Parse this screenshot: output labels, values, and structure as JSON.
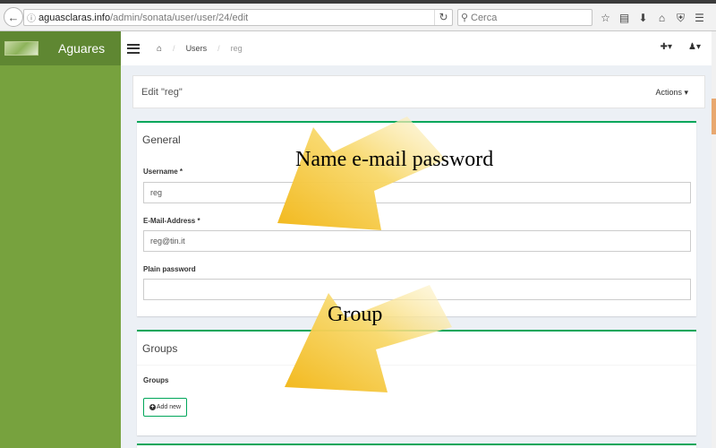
{
  "browser": {
    "url_host": "aguasclaras.info",
    "url_path": "/admin/sonata/user/user/24/edit",
    "search_placeholder": "Cerca"
  },
  "sidebar": {
    "brand": "Aguares"
  },
  "breadcrumb": {
    "items": [
      "Users"
    ],
    "current": "reg"
  },
  "page": {
    "title": "Edit \"reg\"",
    "actions_label": "Actions"
  },
  "general": {
    "title": "General",
    "username_label": "Username *",
    "username_value": "reg",
    "email_label": "E-Mail-Address *",
    "email_value": "reg@tin.it",
    "password_label": "Plain password",
    "password_value": ""
  },
  "groups": {
    "title": "Groups",
    "field_label": "Groups",
    "add_new_label": "Add new"
  },
  "annotations": {
    "arrow_top_text": "Name  e-mail  password",
    "arrow_bottom_text": "Group"
  },
  "colors": {
    "sidebar": "#77a23e",
    "logo_bar": "#5f8732",
    "panel_accent": "#00a65a",
    "arrow": "#f5c22c"
  }
}
